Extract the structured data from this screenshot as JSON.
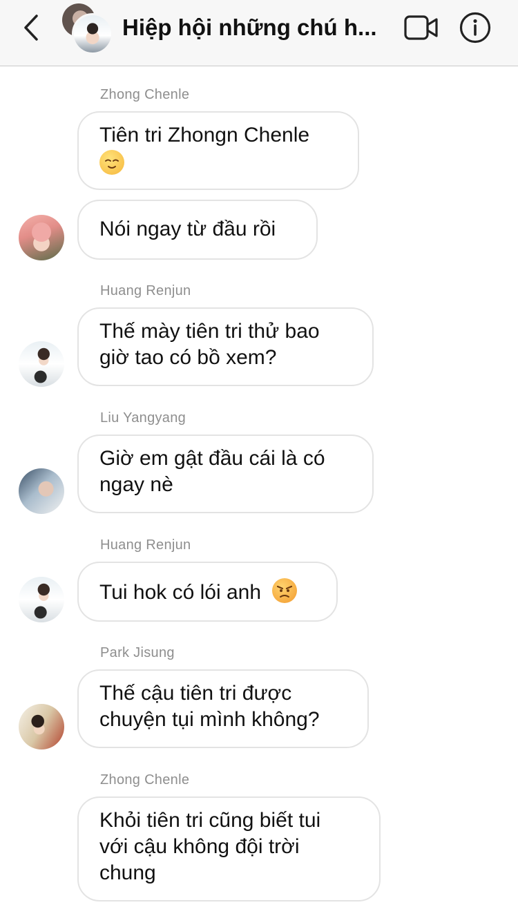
{
  "header": {
    "title": "Hiệp hội những chú h...",
    "back_icon": "chevron-left-icon",
    "video_icon": "video-camera-icon",
    "info_icon": "info-icon"
  },
  "messages": [
    {
      "sender": "Zhong Chenle",
      "text": "Tiên tri Zhongn Chenle",
      "emoji": "relieved-face-emoji"
    },
    {
      "sender": "",
      "text": "Nói ngay từ đầu rồi"
    },
    {
      "sender": "Huang Renjun",
      "line1": "Thế mày tiên tri thử bao",
      "line2": "giờ tao có bồ xem?"
    },
    {
      "sender": "Liu Yangyang",
      "line1": "Giờ em gật đầu cái là có",
      "line2": "ngay nè"
    },
    {
      "sender": "Huang Renjun",
      "text": "Tui hok có lói anh",
      "emoji": "angry-face-emoji"
    },
    {
      "sender": "Park Jisung",
      "line1": "Thế cậu tiên tri được",
      "line2": "chuyện tụi mình không?"
    },
    {
      "sender": "Zhong Chenle",
      "line1": "Khỏi tiên tri cũng biết tui",
      "line2": "với cậu không đội trời",
      "line3": "chung"
    }
  ],
  "colors": {
    "header_bg": "#f7f7f7",
    "bubble_border": "#e3e3e3",
    "sender_text": "#8e8e8e"
  }
}
